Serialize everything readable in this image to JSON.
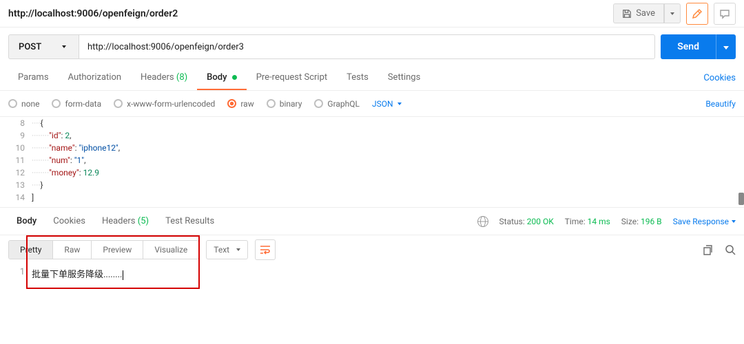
{
  "header": {
    "title": "http://localhost:9006/openfeign/order2",
    "save_label": "Save"
  },
  "request": {
    "method": "POST",
    "url": "http://localhost:9006/openfeign/order3",
    "send_label": "Send"
  },
  "req_tabs": {
    "params": "Params",
    "auth": "Authorization",
    "headers": "Headers",
    "headers_count": "(8)",
    "body": "Body",
    "prerequest": "Pre-request Script",
    "tests": "Tests",
    "settings": "Settings",
    "cookies": "Cookies"
  },
  "body_types": {
    "none": "none",
    "formdata": "form-data",
    "urlencoded": "x-www-form-urlencoded",
    "raw": "raw",
    "binary": "binary",
    "graphql": "GraphQL",
    "content_type": "JSON",
    "beautify": "Beautify"
  },
  "request_code": {
    "lines": [
      {
        "num": "8",
        "indent": "····",
        "text": "{"
      },
      {
        "num": "9",
        "indent": "········",
        "key": "\"id\"",
        "colon": ": ",
        "val": "2",
        "vtype": "num",
        "trail": ","
      },
      {
        "num": "10",
        "indent": "········",
        "key": "\"name\"",
        "colon": ": ",
        "val": "\"iphone12\"",
        "vtype": "str",
        "trail": ","
      },
      {
        "num": "11",
        "indent": "········",
        "key": "\"num\"",
        "colon": ": ",
        "val": "\"1\"",
        "vtype": "str",
        "trail": ","
      },
      {
        "num": "12",
        "indent": "········",
        "key": "\"money\"",
        "colon": ": ",
        "val": "12.9",
        "vtype": "num",
        "trail": ""
      },
      {
        "num": "13",
        "indent": "····",
        "text": "}"
      },
      {
        "num": "14",
        "indent": "",
        "text": "]"
      }
    ]
  },
  "resp_tabs": {
    "body": "Body",
    "cookies": "Cookies",
    "headers": "Headers",
    "headers_count": "(5)",
    "testresults": "Test Results"
  },
  "status": {
    "label": "Status:",
    "value": "200 OK",
    "time_label": "Time:",
    "time_value": "14 ms",
    "size_label": "Size:",
    "size_value": "196 B",
    "save_response": "Save Response"
  },
  "view_modes": {
    "pretty": "Pretty",
    "raw": "Raw",
    "preview": "Preview",
    "visualize": "Visualize",
    "format": "Text"
  },
  "response_body": {
    "line_num": "1",
    "text": "批量下单服务降级........"
  }
}
